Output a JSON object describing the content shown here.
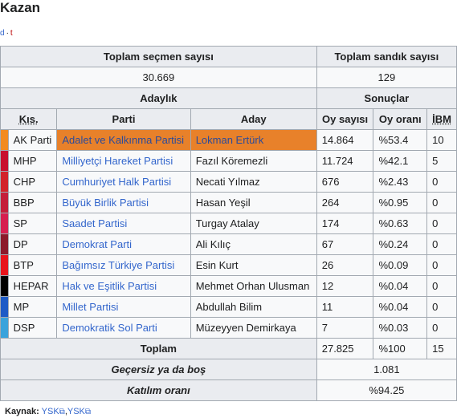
{
  "title": "Kazan",
  "navbar": {
    "d": "d",
    "sep": "·",
    "t": "t"
  },
  "headers": {
    "total_voters": "Toplam seçmen sayısı",
    "total_boxes": "Toplam sandık sayısı",
    "candidacy": "Adaylık",
    "results": "Sonuçlar",
    "abbr": "Kıs.",
    "party": "Parti",
    "candidate": "Aday",
    "votes": "Oy sayısı",
    "vote_rate": "Oy oranı",
    "ibm": "İBM"
  },
  "totals": {
    "voters": "30.669",
    "boxes": "129"
  },
  "rows": [
    {
      "color": "#f28b20",
      "abbr": "AK Parti",
      "party": "Adalet ve Kalkınma Partisi",
      "candidate": "Lokman Ertürk",
      "votes": "14.864",
      "rate": "%53.4",
      "ibm": "10",
      "highlight": true
    },
    {
      "color": "#c8102e",
      "abbr": "MHP",
      "party": "Milliyetçi Hareket Partisi",
      "candidate": "Fazıl Köremezli",
      "votes": "11.724",
      "rate": "%42.1",
      "ibm": "5"
    },
    {
      "color": "#d2232a",
      "abbr": "CHP",
      "party": "Cumhuriyet Halk Partisi",
      "candidate": "Necati Yılmaz",
      "votes": "676",
      "rate": "%2.43",
      "ibm": "0"
    },
    {
      "color": "#c41e3a",
      "abbr": "BBP",
      "party": "Büyük Birlik Partisi",
      "candidate": "Hasan Yeşil",
      "votes": "264",
      "rate": "%0.95",
      "ibm": "0"
    },
    {
      "color": "#d61f4f",
      "abbr": "SP",
      "party": "Saadet Partisi",
      "candidate": "Turgay Atalay",
      "votes": "174",
      "rate": "%0.63",
      "ibm": "0"
    },
    {
      "color": "#8b1a2b",
      "abbr": "DP",
      "party": "Demokrat Parti",
      "candidate": "Ali Kılıç",
      "votes": "67",
      "rate": "%0.24",
      "ibm": "0"
    },
    {
      "color": "#e8141c",
      "abbr": "BTP",
      "party": "Bağımsız Türkiye Partisi",
      "candidate": "Esin Kurt",
      "votes": "26",
      "rate": "%0.09",
      "ibm": "0"
    },
    {
      "color": "#000000",
      "abbr": "HEPAR",
      "party": "Hak ve Eşitlik Partisi",
      "candidate": "Mehmet Orhan Ulusman",
      "votes": "12",
      "rate": "%0.04",
      "ibm": "0"
    },
    {
      "color": "#1e5bc6",
      "abbr": "MP",
      "party": "Millet Partisi",
      "candidate": "Abdullah Bilim",
      "votes": "11",
      "rate": "%0.04",
      "ibm": "0"
    },
    {
      "color": "#3aa3dc",
      "abbr": "DSP",
      "party": "Demokratik Sol Parti",
      "candidate": "Müzeyyen Demirkaya",
      "votes": "7",
      "rate": "%0.03",
      "ibm": "0"
    }
  ],
  "total_row": {
    "label": "Toplam",
    "votes": "27.825",
    "rate": "%100",
    "ibm": "15"
  },
  "invalid": {
    "label": "Geçersiz ya da boş",
    "value": "1.081"
  },
  "turnout": {
    "label": "Katılım oranı",
    "value": "%94.25"
  },
  "source": {
    "label": "Kaynak:",
    "link1": "YSK",
    "sep": ",",
    "link2": "YSK",
    "ext_icon": "external-link-icon"
  }
}
